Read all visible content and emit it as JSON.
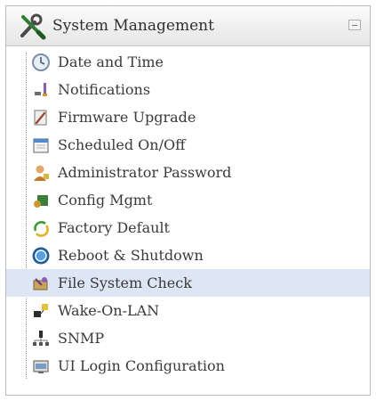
{
  "panel": {
    "title": "System Management",
    "header_icon": "tools-icon",
    "collapse_icon": "collapse-icon"
  },
  "menu": {
    "selected_index": 9,
    "items": [
      {
        "label": "Date and Time",
        "icon": "clock-icon"
      },
      {
        "label": "Notifications",
        "icon": "notification-icon"
      },
      {
        "label": "Firmware Upgrade",
        "icon": "firmware-icon"
      },
      {
        "label": "Scheduled On/Off",
        "icon": "calendar-icon"
      },
      {
        "label": "Administrator Password",
        "icon": "admin-user-icon"
      },
      {
        "label": "Config Mgmt",
        "icon": "config-icon"
      },
      {
        "label": "Factory Default",
        "icon": "refresh-icon"
      },
      {
        "label": "Reboot & Shutdown",
        "icon": "power-icon"
      },
      {
        "label": "File System Check",
        "icon": "file-check-icon"
      },
      {
        "label": "Wake-On-LAN",
        "icon": "wake-on-lan-icon"
      },
      {
        "label": "SNMP",
        "icon": "network-icon"
      },
      {
        "label": "UI Login Configuration",
        "icon": "login-config-icon"
      }
    ]
  },
  "colors": {
    "selected_row": "#dde6f4",
    "header_top": "#fbfbfb",
    "header_bottom": "#e6e6e6"
  }
}
